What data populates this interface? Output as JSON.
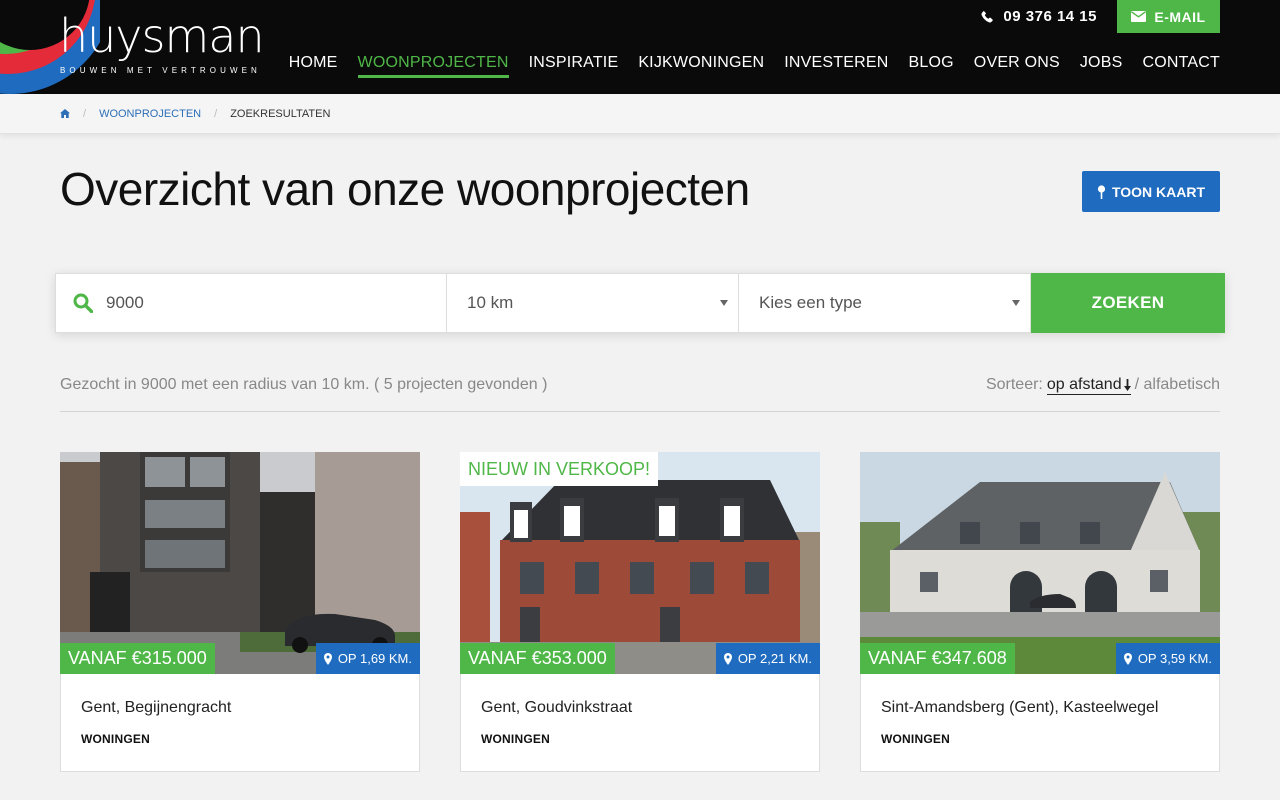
{
  "brand": {
    "name": "huysman",
    "tagline": "BOUWEN MET VERTROUWEN",
    "green": "#4fb747",
    "blue": "#1f6bbf"
  },
  "topbar": {
    "phone": "09 376 14 15",
    "email_label": "E-MAIL"
  },
  "nav": [
    {
      "label": "HOME",
      "active": false
    },
    {
      "label": "WOONPROJECTEN",
      "active": true
    },
    {
      "label": "INSPIRATIE",
      "active": false
    },
    {
      "label": "KIJKWONINGEN",
      "active": false
    },
    {
      "label": "INVESTEREN",
      "active": false
    },
    {
      "label": "BLOG",
      "active": false
    },
    {
      "label": "OVER ONS",
      "active": false
    },
    {
      "label": "JOBS",
      "active": false
    },
    {
      "label": "CONTACT",
      "active": false
    }
  ],
  "breadcrumb": {
    "home_icon": "home-icon",
    "section": "WOONPROJECTEN",
    "current": "ZOEKRESULTATEN"
  },
  "page": {
    "title": "Overzicht van onze woonprojecten",
    "map_button": "TOON KAART"
  },
  "search": {
    "location_value": "9000",
    "radius_value": "10 km",
    "type_placeholder": "Kies een type",
    "submit_label": "ZOEKEN"
  },
  "results": {
    "summary": "Gezocht in 9000 met een radius van 10 km. ( 5 projecten gevonden )",
    "sort_label": "Sorteer:",
    "sort_selected": "op afstand",
    "sort_alt": "/ alfabetisch"
  },
  "cards": [
    {
      "badge": "",
      "price": "VANAF €315.000",
      "distance": "OP 1,69 KM.",
      "location": "Gent, Begijnengracht",
      "type": "WONINGEN"
    },
    {
      "badge": "NIEUW IN VERKOOP!",
      "price": "VANAF €353.000",
      "distance": "OP 2,21 KM.",
      "location": "Gent, Goudvinkstraat",
      "type": "WONINGEN"
    },
    {
      "badge": "",
      "price": "VANAF €347.608",
      "distance": "OP 3,59 KM.",
      "location": "Sint-Amandsberg (Gent), Kasteelwegel",
      "type": "WONINGEN"
    }
  ]
}
